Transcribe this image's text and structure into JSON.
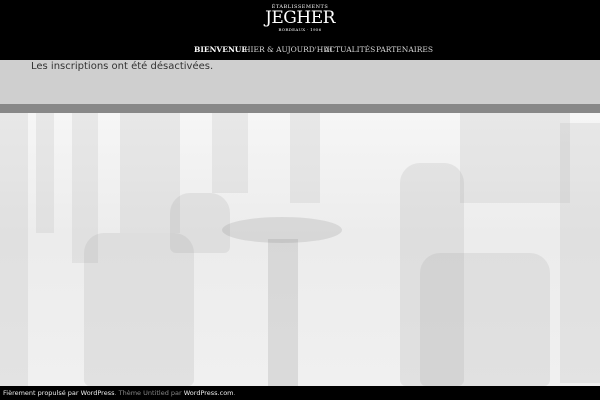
{
  "header": {
    "logo": {
      "top_text": "ÉTABLISSEMENTS",
      "main_text": "JEGHER",
      "sub_text": "BORDEAUX · 1956"
    }
  },
  "nav": {
    "items": [
      {
        "label": "BIENVENUE",
        "active": true
      },
      {
        "label": "HIER & AUJOURD'HUI",
        "active": false
      },
      {
        "label": "ACTUALITÉS",
        "active": false
      },
      {
        "label": "PARTENAIRES",
        "active": false
      }
    ]
  },
  "notice": {
    "text": "Les inscriptions ont été désactivées."
  },
  "footer": {
    "powered_text": "Fièrement propulsé par WordPress",
    "separator": ".",
    "theme_prefix": "Thème Untitled par",
    "theme_link": "WordPress.com",
    "theme_suffix": "."
  },
  "colors": {
    "header_bg": "#000000",
    "notice_bg": "#cfcfcf",
    "divider": "#888888",
    "footer_bg": "#000000"
  }
}
